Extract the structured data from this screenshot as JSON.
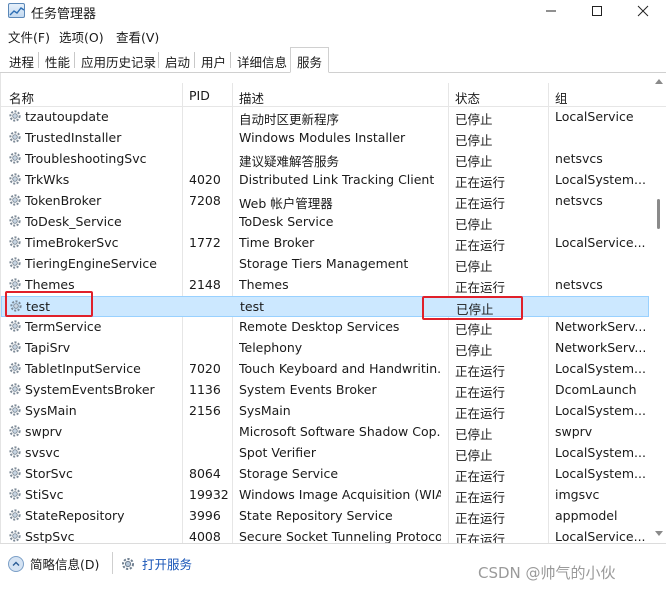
{
  "window": {
    "title": "任务管理器"
  },
  "menu": {
    "file": "文件(F)",
    "options": "选项(O)",
    "view": "查看(V)"
  },
  "tabs": [
    {
      "label": "进程"
    },
    {
      "label": "性能"
    },
    {
      "label": "应用历史记录"
    },
    {
      "label": "启动"
    },
    {
      "label": "用户"
    },
    {
      "label": "详细信息"
    },
    {
      "label": "服务"
    }
  ],
  "columns": {
    "name": "名称",
    "pid": "PID",
    "description": "描述",
    "status": "状态",
    "group": "组"
  },
  "services": [
    {
      "name": "tzautoupdate",
      "pid": "",
      "description": "自动时区更新程序",
      "status": "已停止",
      "group": "LocalService"
    },
    {
      "name": "TrustedInstaller",
      "pid": "",
      "description": "Windows Modules Installer",
      "status": "已停止",
      "group": ""
    },
    {
      "name": "TroubleshootingSvc",
      "pid": "",
      "description": "建议疑难解答服务",
      "status": "已停止",
      "group": "netsvcs"
    },
    {
      "name": "TrkWks",
      "pid": "4020",
      "description": "Distributed Link Tracking Client",
      "status": "正在运行",
      "group": "LocalSystem..."
    },
    {
      "name": "TokenBroker",
      "pid": "7208",
      "description": "Web 帐户管理器",
      "status": "正在运行",
      "group": "netsvcs"
    },
    {
      "name": "ToDesk_Service",
      "pid": "",
      "description": "ToDesk Service",
      "status": "已停止",
      "group": ""
    },
    {
      "name": "TimeBrokerSvc",
      "pid": "1772",
      "description": "Time Broker",
      "status": "正在运行",
      "group": "LocalService..."
    },
    {
      "name": "TieringEngineService",
      "pid": "",
      "description": "Storage Tiers Management",
      "status": "已停止",
      "group": ""
    },
    {
      "name": "Themes",
      "pid": "2148",
      "description": "Themes",
      "status": "正在运行",
      "group": "netsvcs"
    },
    {
      "name": "test",
      "pid": "",
      "description": "test",
      "status": "已停止",
      "group": ""
    },
    {
      "name": "TermService",
      "pid": "",
      "description": "Remote Desktop Services",
      "status": "已停止",
      "group": "NetworkServ..."
    },
    {
      "name": "TapiSrv",
      "pid": "",
      "description": "Telephony",
      "status": "已停止",
      "group": "NetworkServ..."
    },
    {
      "name": "TabletInputService",
      "pid": "7020",
      "description": "Touch Keyboard and Handwritin...",
      "status": "正在运行",
      "group": "LocalSystem..."
    },
    {
      "name": "SystemEventsBroker",
      "pid": "1136",
      "description": "System Events Broker",
      "status": "正在运行",
      "group": "DcomLaunch"
    },
    {
      "name": "SysMain",
      "pid": "2156",
      "description": "SysMain",
      "status": "正在运行",
      "group": "LocalSystem..."
    },
    {
      "name": "swprv",
      "pid": "",
      "description": "Microsoft Software Shadow Cop...",
      "status": "已停止",
      "group": "swprv"
    },
    {
      "name": "svsvc",
      "pid": "",
      "description": "Spot Verifier",
      "status": "已停止",
      "group": "LocalSystem..."
    },
    {
      "name": "StorSvc",
      "pid": "8064",
      "description": "Storage Service",
      "status": "正在运行",
      "group": "LocalSystem..."
    },
    {
      "name": "StiSvc",
      "pid": "19932",
      "description": "Windows Image Acquisition (WIA)",
      "status": "正在运行",
      "group": "imgsvc"
    },
    {
      "name": "StateRepository",
      "pid": "3996",
      "description": "State Repository Service",
      "status": "正在运行",
      "group": "appmodel"
    },
    {
      "name": "SstpSvc",
      "pid": "4008",
      "description": "Secure Socket Tunneling Protoco...",
      "status": "正在运行",
      "group": "LocalService..."
    }
  ],
  "footer": {
    "fewer_details": "简略信息(D)",
    "open_services": "打开服务"
  },
  "watermark": "CSDN @帅气的小伙",
  "colors": {
    "selection_bg": "#cce8ff",
    "selection_border": "#99d1ff",
    "highlight_red": "#e0202a",
    "link_blue": "#1a56b8"
  }
}
